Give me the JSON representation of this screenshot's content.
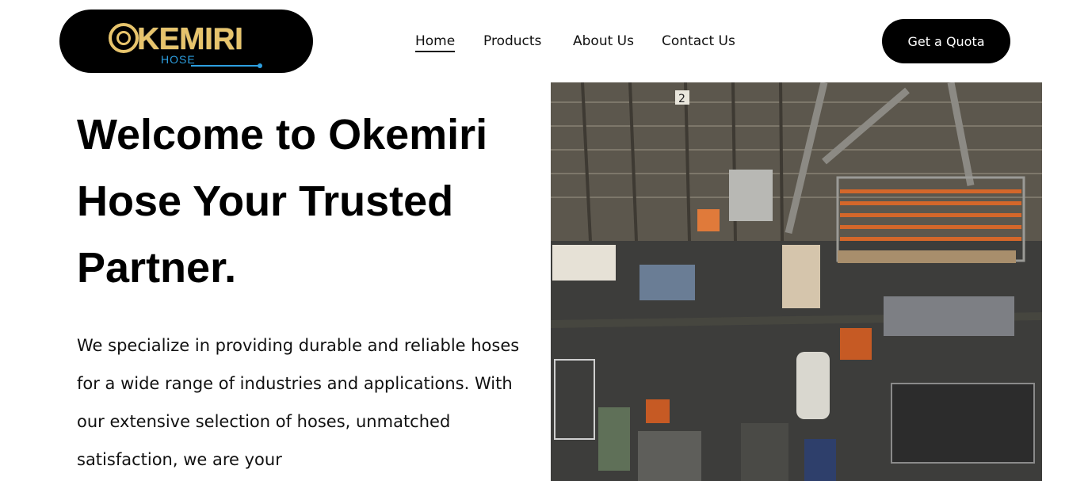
{
  "brand": {
    "name": "OKEMIRI",
    "sub": "HOSE",
    "colors": {
      "gold": "#e7c46c",
      "blue": "#2d9fe0"
    }
  },
  "nav": {
    "items": [
      {
        "label": "Home",
        "active": true
      },
      {
        "label": "Products",
        "active": false
      },
      {
        "label": "About Us",
        "active": false
      },
      {
        "label": "Contact Us",
        "active": false
      }
    ]
  },
  "cta": {
    "label": "Get a Quota"
  },
  "hero": {
    "title": "Welcome to Okemiri Hose Your Trusted Partner.",
    "text": "We specialize in providing durable and reliable hoses for a wide range of industries and applications. With our extensive selection of hoses, unmatched satisfaction, we are your",
    "image": {
      "subject": "industrial warehouse interior seen from above",
      "bay_number": "2",
      "colors": {
        "floor": "#3d3d3b",
        "rack": "#d4672a",
        "wall": "#5a554c"
      }
    }
  },
  "theme": {
    "background": "#ffffff",
    "text": "#000000",
    "button": "#000000",
    "button_text": "#ffffff"
  }
}
